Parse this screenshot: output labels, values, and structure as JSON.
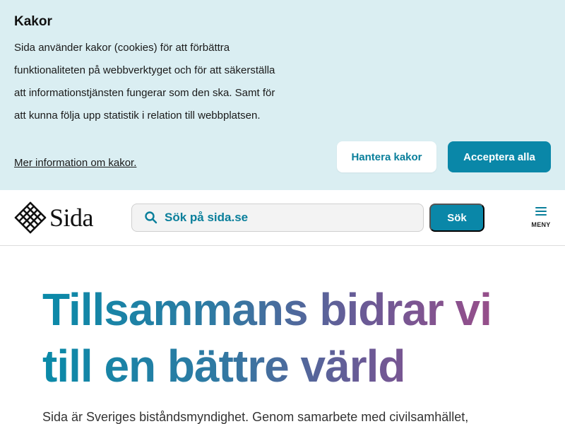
{
  "cookie": {
    "title": "Kakor",
    "text": "Sida använder kakor (cookies) för att förbättra funktionaliteten på webbverktyget och för att säkerställa att informationstjänsten fungerar som den ska. Samt för att kunna följa upp statistik i relation till webbplatsen.",
    "more_link": "Mer information om kakor.",
    "manage_button": "Hantera kakor",
    "accept_button": "Acceptera alla"
  },
  "header": {
    "logo_text": "Sida",
    "search_placeholder": "Sök på sida.se",
    "search_button": "Sök",
    "menu_label": "MENY",
    "icons": {
      "logo": "sida-logo-icon",
      "search": "search-icon",
      "menu": "hamburger-menu-icon"
    }
  },
  "hero": {
    "title": "Tillsammans bidrar vi till en bättre värld",
    "intro": "Sida är Sveriges biståndsmyndighet. Genom samarbete med civilsamhället,"
  },
  "colors": {
    "banner_bg": "#daeef2",
    "accent": "#0a87a8",
    "gradient_start": "#0a8aa8",
    "gradient_end": "#a64a86"
  }
}
